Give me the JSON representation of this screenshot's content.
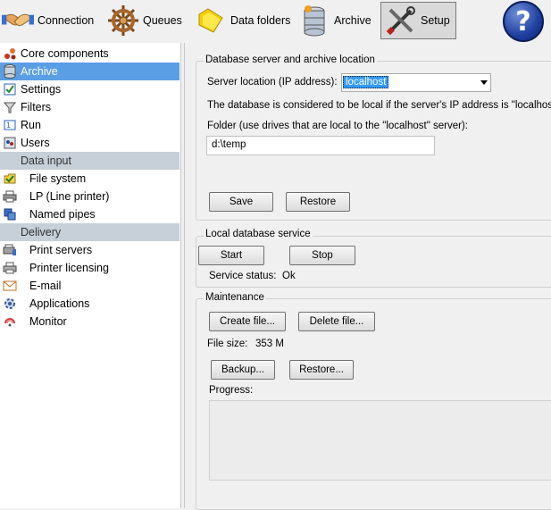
{
  "toolbar": {
    "connection": "Connection",
    "queues": "Queues",
    "data_folders": "Data folders",
    "archive": "Archive",
    "setup": "Setup",
    "help": "?"
  },
  "sidebar": {
    "items": [
      {
        "label": "Core components",
        "icon": "core-components-icon"
      },
      {
        "label": "Archive",
        "icon": "database-icon"
      },
      {
        "label": "Settings",
        "icon": "settings-icon"
      },
      {
        "label": "Filters",
        "icon": "filter-icon"
      },
      {
        "label": "Run",
        "icon": "run-icon"
      },
      {
        "label": "Users",
        "icon": "users-icon"
      }
    ],
    "data_input_header": "Data input",
    "data_input_items": [
      {
        "label": "File system",
        "icon": "file-system-icon"
      },
      {
        "label": "LP (Line printer)",
        "icon": "printer-icon"
      },
      {
        "label": "Named pipes",
        "icon": "named-pipes-icon"
      }
    ],
    "delivery_header": "Delivery",
    "delivery_items": [
      {
        "label": "Print servers",
        "icon": "print-server-icon"
      },
      {
        "label": "Printer licensing",
        "icon": "printer-licensing-icon"
      },
      {
        "label": "E-mail",
        "icon": "email-icon"
      },
      {
        "label": "Applications",
        "icon": "applications-icon"
      },
      {
        "label": "Monitor",
        "icon": "monitor-icon"
      }
    ],
    "selected": "Archive"
  },
  "db_group": {
    "title": "Database server and archive location",
    "server_label": "Server location (IP address):",
    "server_value": "localhost",
    "note": "The database is considered to be local if the server's IP address is \"localhost\"",
    "folder_label": "Folder (use drives that are local to the \"localhost\" server):",
    "folder_value": "d:\\temp",
    "save": "Save",
    "restore": "Restore"
  },
  "service_group": {
    "title": "Local database service",
    "start": "Start",
    "stop": "Stop",
    "status_label": "Service status:",
    "status_value": "Ok"
  },
  "maintenance_group": {
    "title": "Maintenance",
    "create": "Create file...",
    "delete": "Delete file...",
    "size_label": "File size:",
    "size_value": "353 M",
    "backup": "Backup...",
    "restore": "Restore...",
    "progress_label": "Progress:"
  },
  "colors": {
    "selection": "#5a9ee6",
    "header_band": "#c7cfd8",
    "dropdown_highlight": "#3399ff"
  }
}
